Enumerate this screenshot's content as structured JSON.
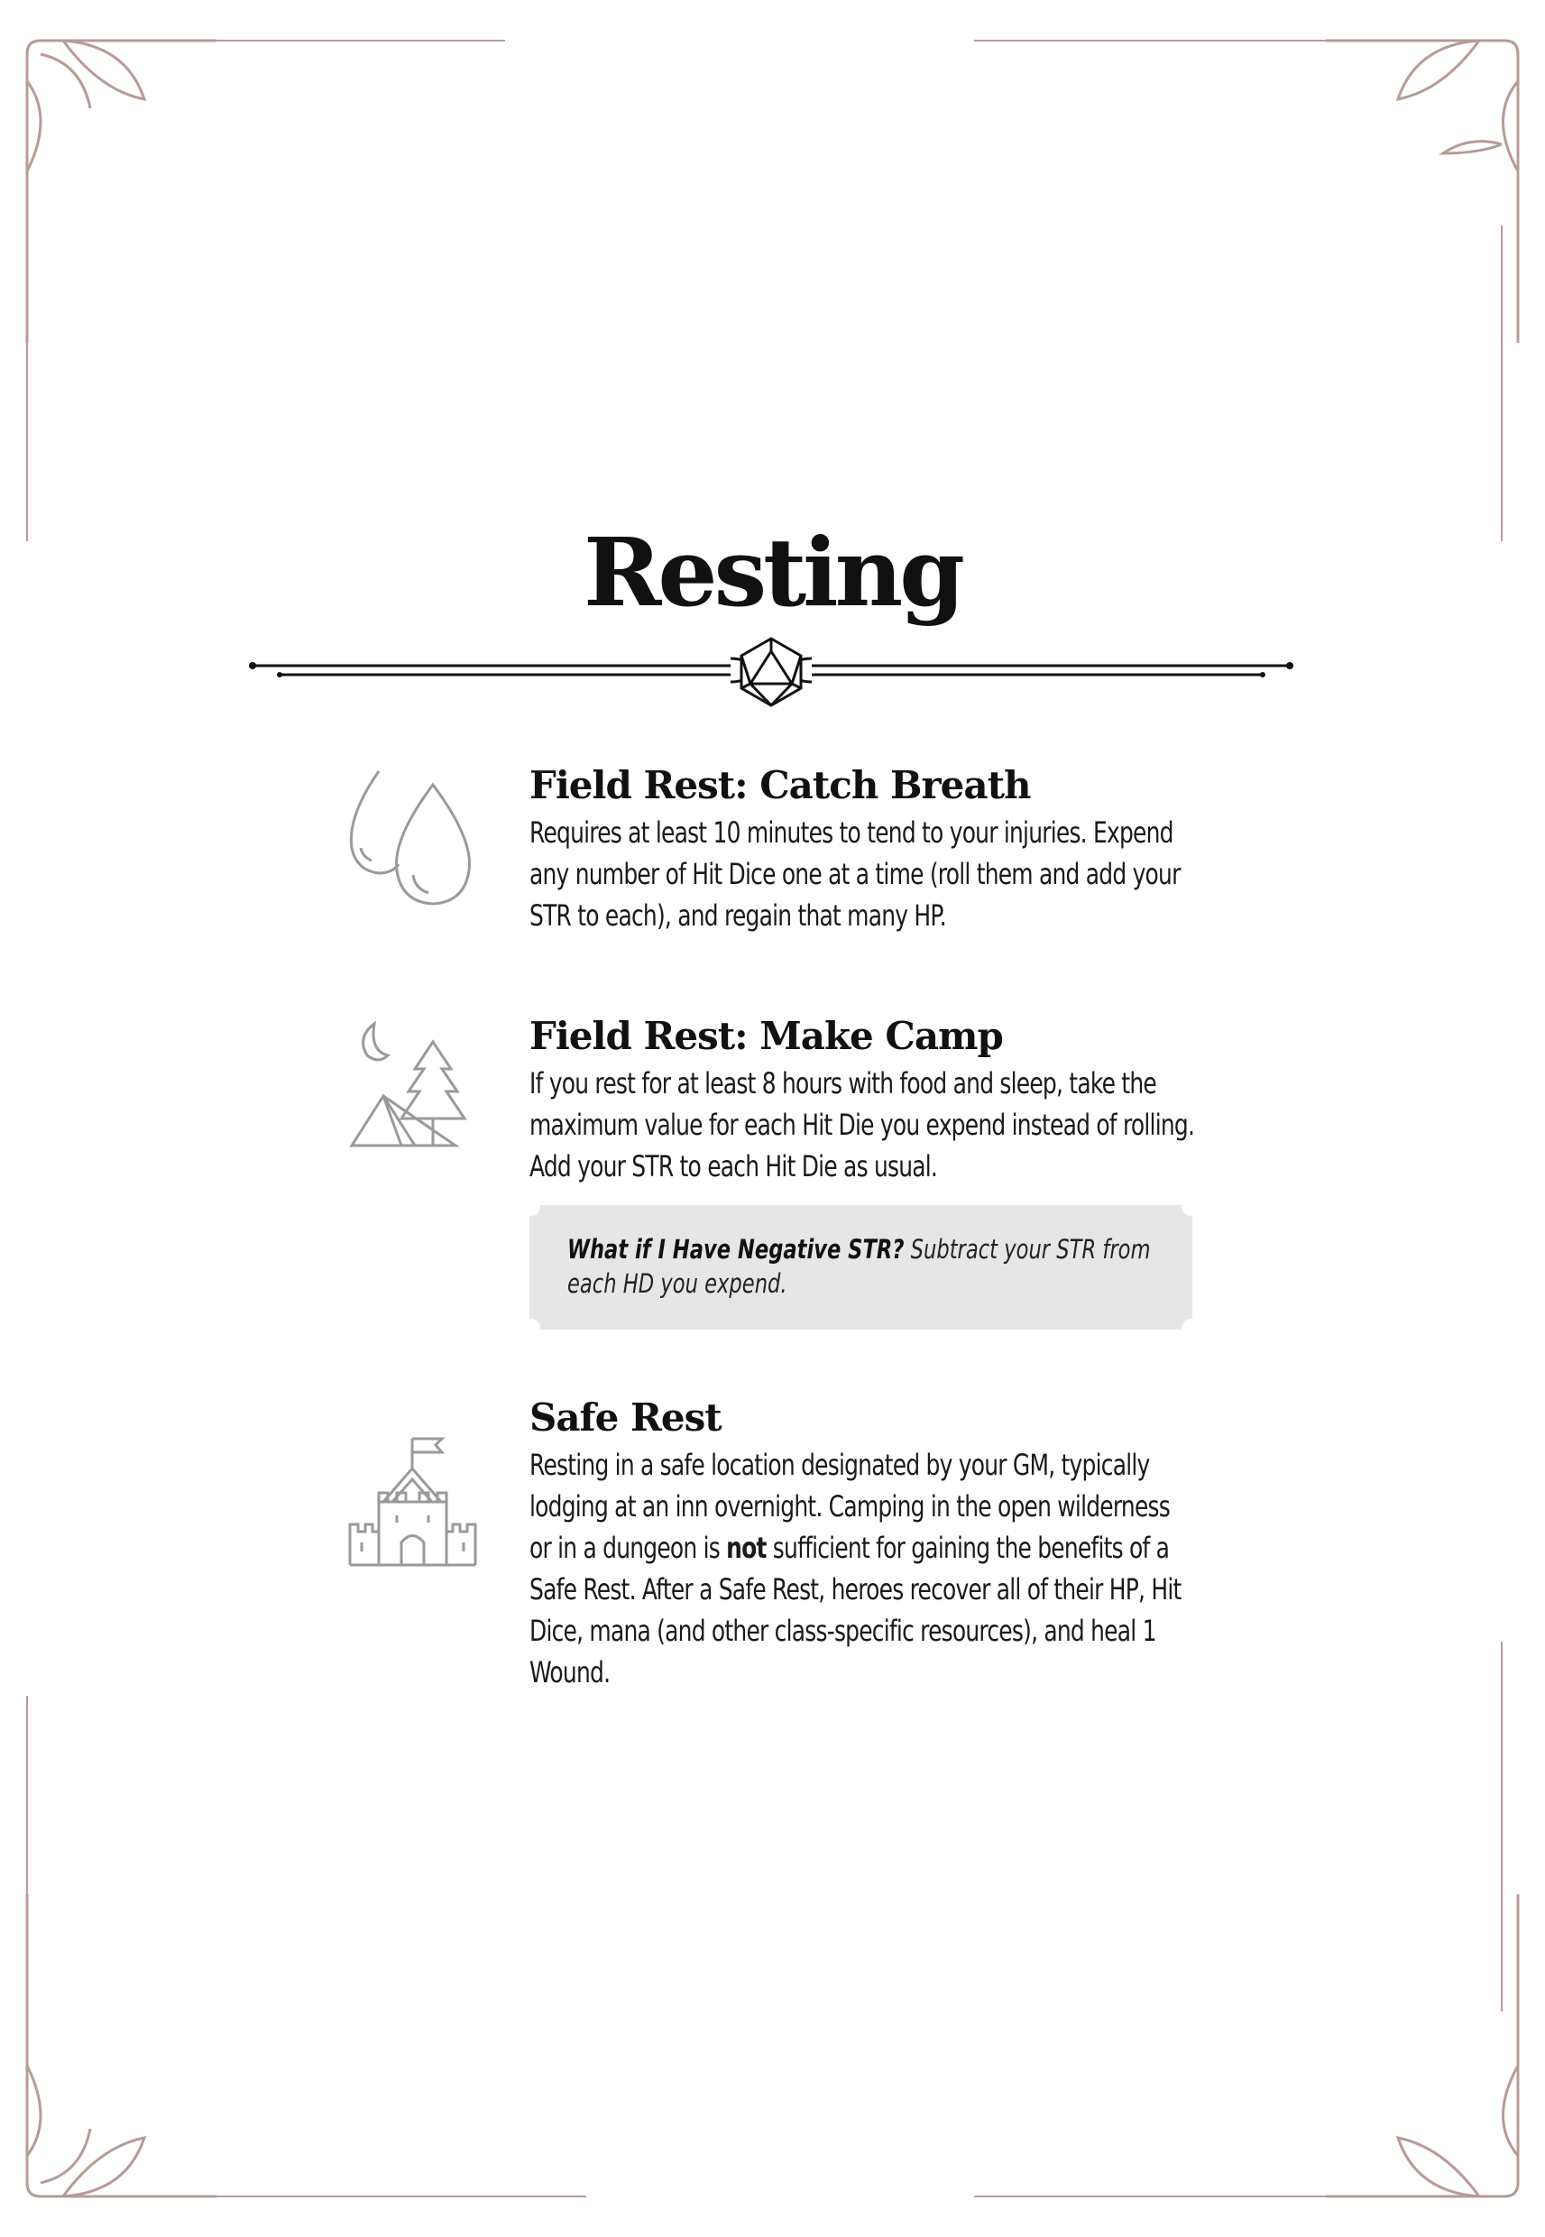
{
  "page": {
    "title": "Resting"
  },
  "sections": [
    {
      "heading": "Field Rest: Catch Breath",
      "icon": "water-drops-icon",
      "body": "Requires at least 10 minutes to tend to your injuries. Expend any number of Hit Dice one at a time (roll them and add your STR to each), and regain that many HP."
    },
    {
      "heading": "Field Rest: Make Camp",
      "icon": "camp-tent-icon",
      "body": "If you rest for at least 8 hours with food and sleep, take the maximum value for each Hit Die you expend instead of rolling. Add your STR to each Hit Die as usual."
    },
    {
      "heading": "Safe Rest",
      "icon": "castle-icon",
      "body_before": "Resting in a safe location designated by your GM, typically lodging at an inn overnight. Camping in the open wilderness or in a dungeon is ",
      "body_bold": "not",
      "body_after": " sufficient for gaining the benefits of a Safe Rest. After a Safe Rest, heroes recover all of their HP, Hit Dice, mana (and other class-specific resources), and heal 1 Wound."
    }
  ],
  "callout": {
    "question": "What if I Have Negative STR?",
    "answer": " Subtract your STR from each HD you expend."
  },
  "colors": {
    "frame": "#b89a98",
    "icon": "#9a9a9a",
    "callout_bg": "#e6e6e6"
  }
}
